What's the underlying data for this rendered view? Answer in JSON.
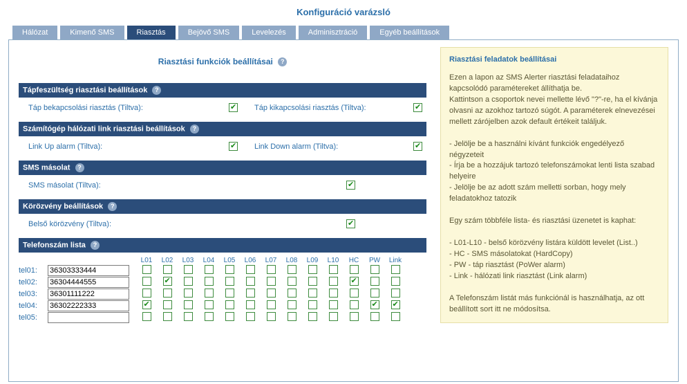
{
  "title": "Konfiguráció varázsló",
  "tabs": [
    "Hálózat",
    "Kimenő SMS",
    "Riasztás",
    "Bejövő SMS",
    "Levelezés",
    "Adminisztráció",
    "Egyéb beállítások"
  ],
  "active_tab": 2,
  "subtitle": "Riasztási funkciók beállításai",
  "help_glyph": "?",
  "sections": {
    "power": {
      "header": "Tápfeszültség riasztási beállítások",
      "on_label": "Táp bekapcsolási riasztás (Tiltva):",
      "on_checked": true,
      "off_label": "Táp kikapcsolási riasztás (Tiltva):",
      "off_checked": true
    },
    "link": {
      "header": "Számítógép hálózati link riasztási beállítások",
      "up_label": "Link Up alarm (Tiltva):",
      "up_checked": true,
      "down_label": "Link Down alarm (Tiltva):",
      "down_checked": true
    },
    "sms": {
      "header": "SMS másolat",
      "label": "SMS másolat (Tiltva):",
      "checked": true
    },
    "circ": {
      "header": "Körözvény beállítások",
      "label": "Belső körözvény (Tiltva):",
      "checked": true
    },
    "phones": {
      "header": "Telefonszám lista",
      "cols": [
        "L01",
        "L02",
        "L03",
        "L04",
        "L05",
        "L06",
        "L07",
        "L08",
        "L09",
        "L10",
        "HC",
        "PW",
        "Link"
      ],
      "rows": [
        {
          "tl": "tel01:",
          "num": "36303333444",
          "chk": [
            false,
            false,
            false,
            false,
            false,
            false,
            false,
            false,
            false,
            false,
            false,
            false,
            false
          ]
        },
        {
          "tl": "tel02:",
          "num": "36304444555",
          "chk": [
            false,
            true,
            false,
            false,
            false,
            false,
            false,
            false,
            false,
            false,
            true,
            false,
            false
          ]
        },
        {
          "tl": "tel03:",
          "num": "36301111222",
          "chk": [
            false,
            false,
            false,
            false,
            false,
            false,
            false,
            false,
            false,
            false,
            false,
            false,
            false
          ]
        },
        {
          "tl": "tel04:",
          "num": "36302222333",
          "chk": [
            true,
            false,
            false,
            false,
            false,
            false,
            false,
            false,
            false,
            false,
            false,
            true,
            true
          ]
        },
        {
          "tl": "tel05:",
          "num": "",
          "chk": [
            false,
            false,
            false,
            false,
            false,
            false,
            false,
            false,
            false,
            false,
            false,
            false,
            false
          ]
        }
      ]
    }
  },
  "help": {
    "title": "Riasztási feladatok beállításai",
    "p1": "Ezen a lapon az SMS Alerter riasztási feladataihoz kapcsolódó paramétereket állíthatja be.",
    "p2": "Kattintson a csoportok nevei mellette lévő \"?\"-re, ha el kívánja olvasni az azokhoz tartozó súgót. A paraméterek elnevezései mellett zárójelben azok default értékeit találjuk.",
    "li1": "- Jelölje be a használni kívánt funkciók engedélyező négyzeteit",
    "li2": "- Írja be a hozzájuk tartozó telefonszámokat lenti lista szabad helyeire",
    "li3": "- Jelölje be az adott szám melletti sorban, hogy mely feladatokhoz tatozik",
    "p3": "Egy szám többféle lista- és riasztási üzenetet is kaphat:",
    "li4": "- L01-L10 - belső körözvény listára küldött levelet (List..)",
    "li5": "- HC - SMS másolatokat (HardCopy)",
    "li6": "- PW - táp riasztást (PoWer alarm)",
    "li7": "- Link - hálózati link riasztást (Link alarm)",
    "p4": "A Telefonszám listát más funkciónál is használhatja, az ott beállított sort itt ne módosítsa."
  }
}
